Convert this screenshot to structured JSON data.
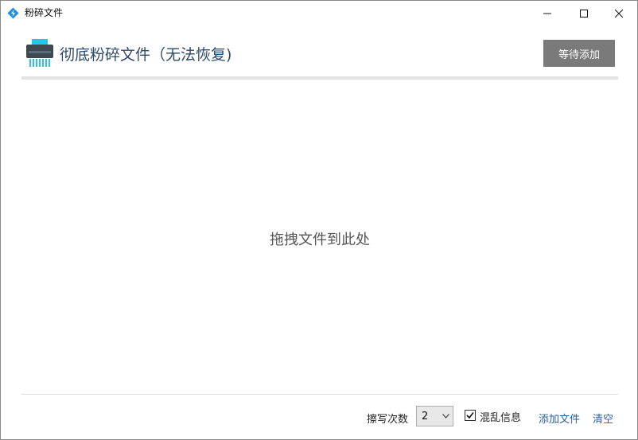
{
  "window": {
    "title": "粉碎文件",
    "controls": {
      "minimize": "minimize-icon",
      "maximize": "maximize-icon",
      "close": "close-icon"
    }
  },
  "header": {
    "icon": "shredder-icon",
    "title": "彻底粉碎文件（无法恢复)",
    "action_label": "等待添加"
  },
  "drop_zone": {
    "text": "拖拽文件到此处"
  },
  "footer": {
    "wipe_label": "擦写次数",
    "wipe_count": "2",
    "scramble_label": "混乱信息",
    "scramble_checked": true,
    "add_file_label": "添加文件",
    "clear_label": "清空"
  },
  "colors": {
    "title_text": "#2d4a6b",
    "button_bg": "#7a7a7a",
    "link": "#2a5f9e",
    "icon_accent": "#29c4ea"
  }
}
